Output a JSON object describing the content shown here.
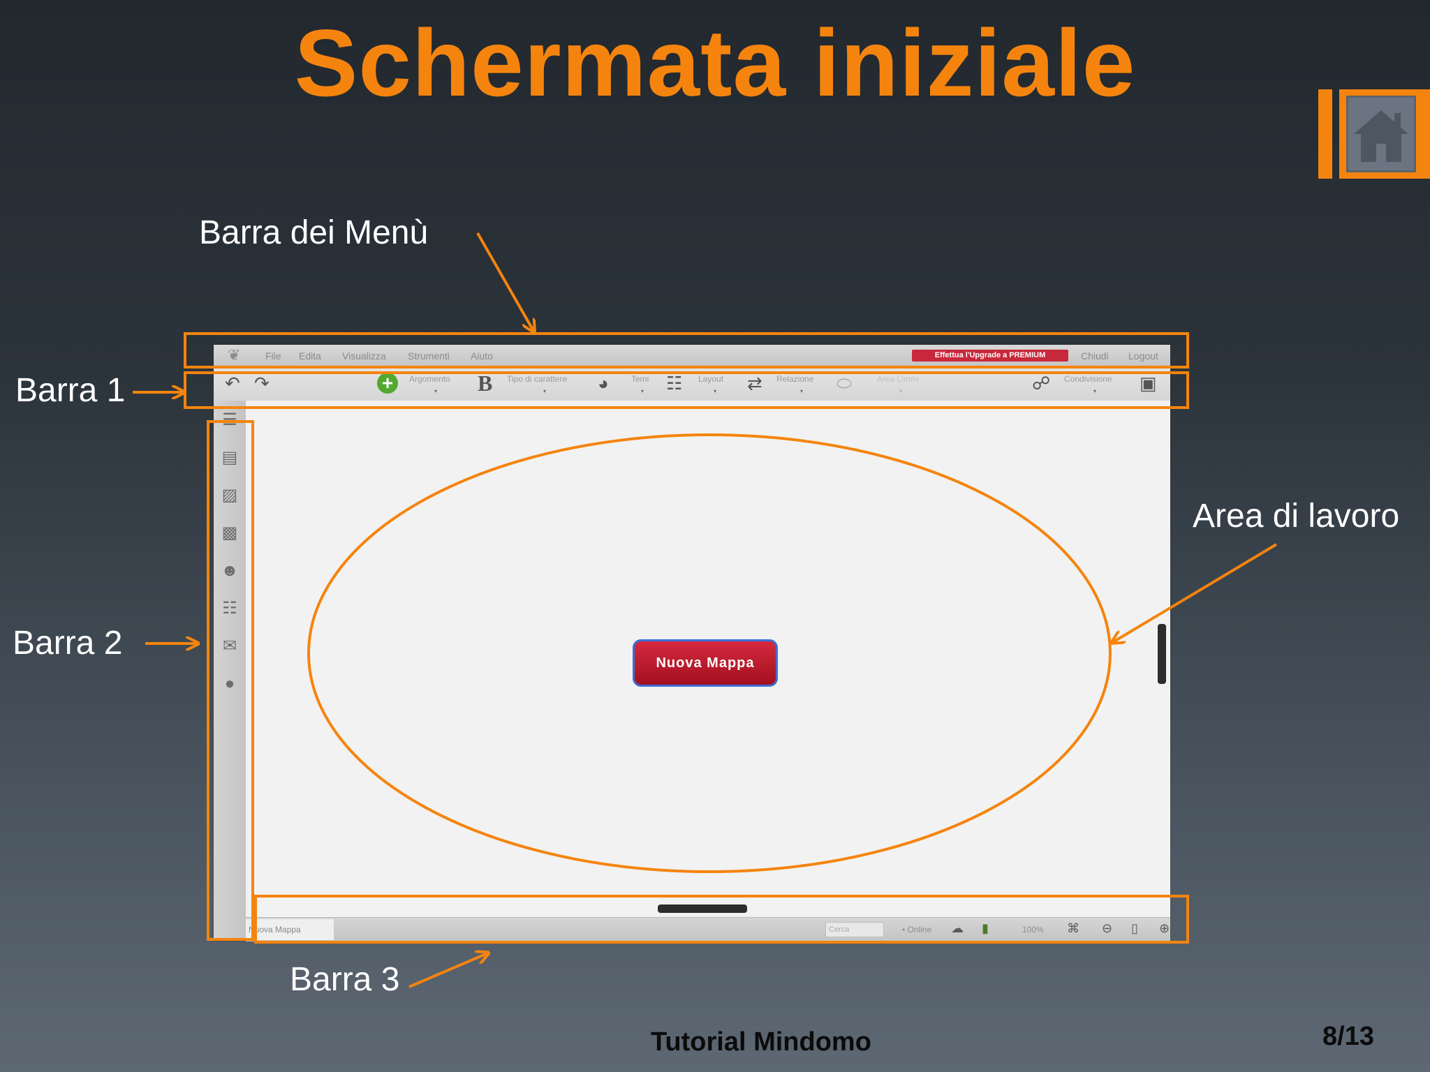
{
  "slide": {
    "title": "Schermata iniziale",
    "footer": "Tutorial Mindomo",
    "page_number": "8/13",
    "accent_color": "#f5840e",
    "home_icon": "home-icon"
  },
  "annotations": {
    "menu_bar": "Barra dei Menù",
    "bar1": "Barra 1",
    "bar2": "Barra 2",
    "bar3": "Barra 3",
    "work_area": "Area di lavoro"
  },
  "app": {
    "menu": {
      "items": [
        "File",
        "Edita",
        "Visualizza",
        "Strumenti",
        "Aiuto"
      ],
      "upgrade_label": "Effettua l'Upgrade a PREMIUM",
      "close_label": "Chiudi",
      "logout_label": "Logout"
    },
    "toolbar": {
      "topic_label": "Argomento",
      "font_label": "Tipo di carattere",
      "themes_label": "Temi",
      "layout_label": "Layout",
      "relation_label": "Relazione",
      "boundary_label": "Area Limite",
      "share_label": "Condivisione"
    },
    "sidebar_icons": [
      "notes-icon",
      "video-icon",
      "image-icon",
      "attachment-icon",
      "emoticon-icon",
      "task-icon",
      "comments-icon",
      "idea-icon"
    ],
    "central_node": "Nuova Mappa",
    "statusbar": {
      "tab_label": "Nuova Mappa",
      "search_placeholder": "Cerca",
      "online_label": "• Online",
      "zoom_label": "100%"
    }
  }
}
